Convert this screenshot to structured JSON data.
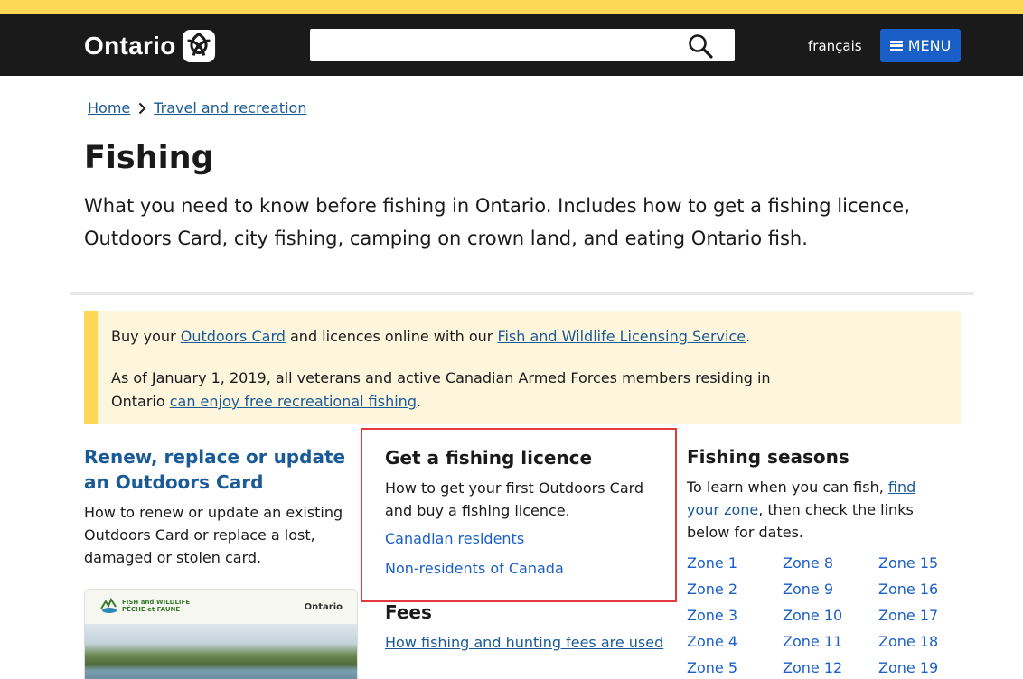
{
  "header": {
    "logo_text": "Ontario",
    "lang_link": "français",
    "menu_label": "MENU",
    "search_value": ""
  },
  "breadcrumb": {
    "home": "Home",
    "current": "Travel and recreation"
  },
  "page": {
    "title": "Fishing",
    "lede": "What you need to know before fishing in Ontario. Includes how to get a fishing licence, Outdoors Card, city fishing, camping on crown land, and eating Ontario fish."
  },
  "callout": {
    "p1_before": "Buy your ",
    "p1_link1": "Outdoors Card",
    "p1_mid": " and licences online with our ",
    "p1_link2": "Fish and Wildlife Licensing Service",
    "p1_after": ".",
    "p2_before": "As of January 1, 2019, all veterans and active Canadian Armed Forces members residing in Ontario ",
    "p2_link": "can enjoy free recreational fishing",
    "p2_after": "."
  },
  "cards": {
    "renew": {
      "title": "Renew, replace or update an Outdoors Card",
      "desc": "How to renew or update an existing Outdoors Card or replace a lost, damaged or stolen card.",
      "image_logo_left_1": "FISH and WILDLIFE",
      "image_logo_left_2": "PÊCHE et FAUNE",
      "image_logo_right": "Ontario"
    },
    "licence": {
      "title": "Get a fishing licence",
      "desc": "How to get your first Outdoors Card and buy a fishing licence.",
      "links": [
        "Canadian residents",
        "Non-residents of Canada"
      ]
    },
    "fees": {
      "title": "Fees",
      "link": "How fishing and hunting fees are used"
    },
    "seasons": {
      "title": "Fishing seasons",
      "desc_before": "To learn when you can fish, ",
      "desc_link": "find your zone",
      "desc_after": ", then check the links below for dates.",
      "zones": [
        "Zone 1",
        "Zone 8",
        "Zone 15",
        "Zone 2",
        "Zone 9",
        "Zone 16",
        "Zone 3",
        "Zone 10",
        "Zone 17",
        "Zone 4",
        "Zone 11",
        "Zone 18",
        "Zone 5",
        "Zone 12",
        "Zone 19"
      ]
    }
  },
  "colors": {
    "header_bg": "#1a1a1a",
    "stripe_yellow": "#fdd756",
    "menu_blue": "#1a5fc7",
    "link_blue": "#1a5a96",
    "callout_bg": "#fef6dc",
    "highlight_red": "#e0393e"
  }
}
